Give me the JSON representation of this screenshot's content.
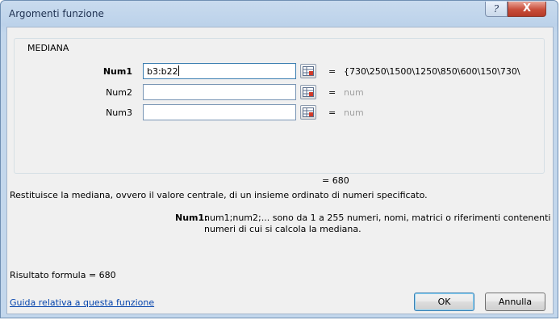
{
  "dialog": {
    "title": "Argomenti funzione",
    "help_label": "?",
    "close_label": "X"
  },
  "function_group": {
    "name": "MEDIANA",
    "args": [
      {
        "label": "Num1",
        "value": "b3:b22",
        "result": "{730\\250\\1500\\1250\\850\\600\\150\\730\\",
        "equals": "="
      },
      {
        "label": "Num2",
        "value": "",
        "result": "num",
        "equals": "="
      },
      {
        "label": "Num3",
        "value": "",
        "result": "num",
        "equals": "="
      }
    ],
    "function_result": "=   680"
  },
  "description": "Restituisce la mediana, ovvero il valore centrale, di un insieme ordinato di numeri specificato.",
  "arg_help": {
    "label": "Num1:",
    "line1": "num1;num2;... sono da 1 a 255 numeri, nomi, matrici o riferimenti contenenti",
    "line2": "numeri di cui si calcola la mediana."
  },
  "formula_result": "Risultato formula =   680",
  "help_link": "Guida relativa a questa funzione",
  "buttons": {
    "ok": "OK",
    "cancel": "Annulla"
  }
}
